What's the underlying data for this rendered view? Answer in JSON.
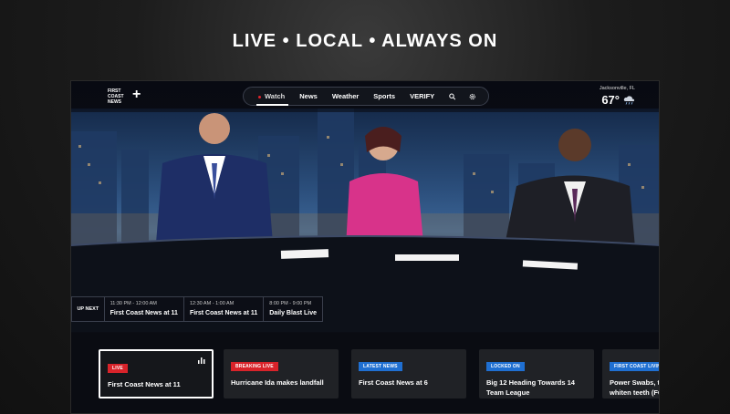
{
  "headline": "LIVE • LOCAL • ALWAYS ON",
  "brand": {
    "logo_text": "FIRST COAST NEWS",
    "logo_symbol": "+"
  },
  "nav": {
    "items": [
      {
        "label": "Watch",
        "active": true
      },
      {
        "label": "News"
      },
      {
        "label": "Weather"
      },
      {
        "label": "Sports"
      },
      {
        "label": "VERIFY"
      }
    ],
    "icons": [
      "search-icon",
      "settings-icon"
    ]
  },
  "weather": {
    "location": "Jacksonville, FL",
    "temperature": "67°",
    "icon": "cloud-rain-icon"
  },
  "up_next": {
    "label": "UP NEXT",
    "items": [
      {
        "time": "11:30 PM - 12:00 AM",
        "title": "First Coast News at 11"
      },
      {
        "time": "12:30 AM - 1:00 AM",
        "title": "First Coast News at 11"
      },
      {
        "time": "8:00 PM - 9:00 PM",
        "title": "Daily Blast Live"
      }
    ]
  },
  "cards": [
    {
      "badge": "LIVE",
      "badge_color": "#d8232a",
      "title": "First Coast News at 11",
      "icon": "equalizer-icon"
    },
    {
      "badge": "BREAKING LIVE",
      "badge_color": "#d8232a",
      "title": "Hurricane Ida makes landfall"
    },
    {
      "badge": "LATEST NEWS",
      "badge_color": "#1f6fd1",
      "title": "First Coast News at 6"
    },
    {
      "badge": "LOCKED ON",
      "badge_color": "#1f6fd1",
      "title": "Big 12 Heading Towards 14 Team League"
    },
    {
      "badge": "FIRST COAST LIVIN",
      "badge_color": "#1f6fd1",
      "title": "Power Swabs, the whiten teeth (FC"
    }
  ],
  "colors": {
    "accent_red": "#d8232a",
    "accent_blue": "#1f6fd1"
  }
}
